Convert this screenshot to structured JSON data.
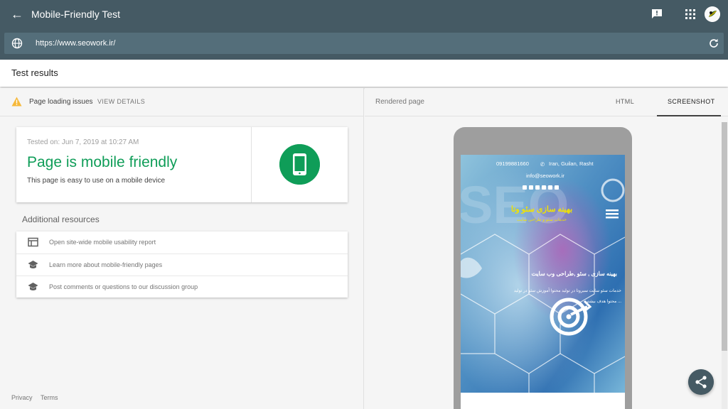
{
  "app": {
    "title": "Mobile-Friendly Test",
    "url_value": "https://www.seowork.ir/",
    "url_placeholder": ""
  },
  "results": {
    "title": "Test results"
  },
  "issues": {
    "label": "Page loading issues",
    "action": "VIEW DETAILS"
  },
  "result_card": {
    "tested_on": "Tested on: Jun 7, 2019 at 10:27 AM",
    "headline": "Page is mobile friendly",
    "description": "This page is easy to use on a mobile device"
  },
  "resources": {
    "title": "Additional resources",
    "items": [
      {
        "label": "Open site-wide mobile usability report",
        "icon": "report-icon"
      },
      {
        "label": "Learn more about mobile-friendly pages",
        "icon": "school-icon"
      },
      {
        "label": "Post comments or questions to our discussion group",
        "icon": "school-icon"
      }
    ]
  },
  "footer": {
    "privacy": "Privacy",
    "terms": "Terms"
  },
  "rendered": {
    "title": "Rendered page",
    "tab_html": "HTML",
    "tab_screenshot": "SCREENSHOT"
  },
  "site": {
    "phone": "09199881660",
    "location": "Iran, Guilan, Rasht",
    "email": "info@seowork.ir",
    "brand": "بهینه سازی سئو وتا",
    "brand_sub": "خدمات سئو و طراحی سایت",
    "slide_title": "بهینه سازی , سئو ,طراحی وب سایت",
    "slide_text1": "خدمات سئو سایت سیروتا در تولید محتوا آموزش سئو در تولید",
    "slide_text2": "محتوا هدف بیشتر ..."
  },
  "colors": {
    "appbar": "#455a64",
    "urlbar": "#546e7a",
    "success": "#0f9d58",
    "warning": "#f6b93b"
  }
}
